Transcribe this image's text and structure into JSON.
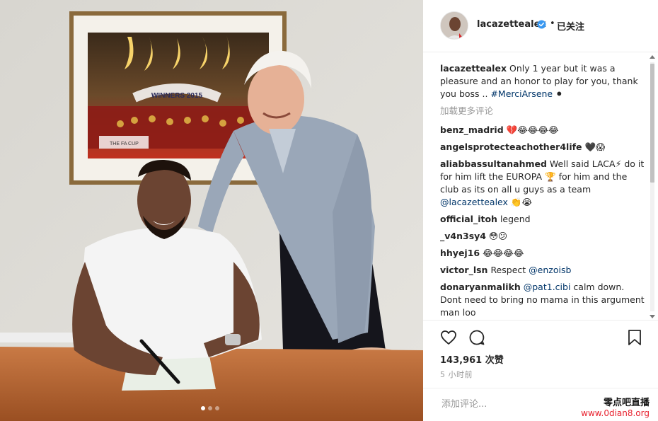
{
  "post": {
    "username": "lacazettealex",
    "follow_dot": "•",
    "follow_status": "已关注",
    "caption_user": "lacazettealex",
    "caption_text": "Only 1 year but it was a pleasure and an honor to play for you, thank you boss ..",
    "caption_tag": "#MerciArsene",
    "caption_emoji": "⚫",
    "load_more": "加载更多评论",
    "likes": "143,961 次赞",
    "time": "5 小时前",
    "add_comment_placeholder": "添加评论...",
    "poster_text": "WINNERS 2015",
    "poster_sub": "THE FA CUP",
    "carousel": {
      "count": 3,
      "active": 1
    }
  },
  "comments": [
    {
      "user": "benz_madrid",
      "text": "💔😂😂😂😂"
    },
    {
      "user": "angelsprotecteachother4life",
      "text": "🖤😱"
    },
    {
      "user": "aliabbassultanahmed",
      "text": "Well said LACA⚡ do it for him lift the EUROPA 🏆 for him and the club as its on all u guys as a team",
      "mention": "@lacazettealex",
      "tail": "👏😭"
    },
    {
      "user": "official_itoh",
      "text": "legend"
    },
    {
      "user": "_v4n3sy4",
      "text": "😳😕"
    },
    {
      "user": "hhyej16",
      "text": "😂😂😂😂"
    },
    {
      "user": "victor_lsn",
      "text": "Respect",
      "mention": "@enzoisb"
    },
    {
      "user": "donaryanmalikh",
      "mention": "@pat1.cibi",
      "text": "calm down. Dont need to bring no mama in this argument man loo"
    }
  ],
  "watermark": {
    "name": "零点吧直播",
    "url": "www.0dian8.org"
  },
  "icons": {
    "like": "heart-icon",
    "comment": "comment-bubble-icon",
    "save": "bookmark-icon",
    "verified": "verified-badge-icon"
  },
  "colors": {
    "link": "#003569",
    "muted": "#999999",
    "verified": "#3897f0",
    "watermark_url": "#e8212e"
  }
}
